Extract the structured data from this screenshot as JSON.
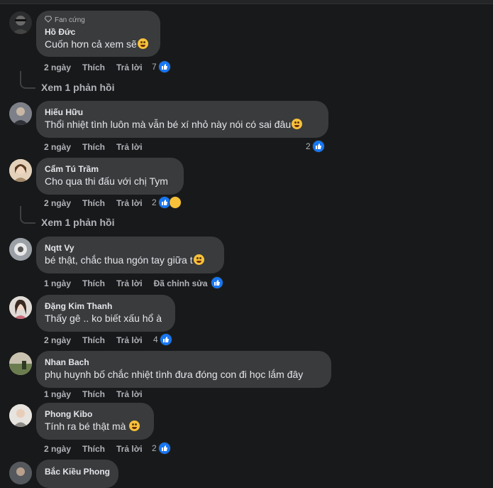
{
  "comments": [
    {
      "author": "Hồ Đức",
      "badge": "Fan cứng",
      "text": "Cuốn hơn cả xem sẽ",
      "emoji": "grin-sweat-icon",
      "time": "2 ngày",
      "like": "Thích",
      "reply": "Trả lời",
      "reactions": "7",
      "see_replies": "Xem 1 phản hồi"
    },
    {
      "author": "Hiếu Hữu",
      "text": "Thổi nhiệt tình luôn mà vẫn bé xí nhỏ này nói có sai đâu",
      "emoji": "rofl-icon",
      "time": "2 ngày",
      "like": "Thích",
      "reply": "Trả lời",
      "reactions": "2"
    },
    {
      "author": "Cẩm Tú Trầm",
      "text": "Cho qua thi đấu với chị Tym",
      "time": "2 ngày",
      "like": "Thích",
      "reply": "Trả lời",
      "reactions": "2",
      "see_replies": "Xem 1 phản hồi"
    },
    {
      "author": "Nqtt Vy",
      "text": "bé thật, chắc thua ngón tay giữa t",
      "emoji": "crying-icon",
      "time": "1 ngày",
      "like": "Thích",
      "reply": "Trả lời",
      "edited": "Đã chỉnh sửa"
    },
    {
      "author": "Đặng Kim Thanh",
      "text": "Thấy gê .. ko biết xấu hổ à",
      "time": "2 ngày",
      "like": "Thích",
      "reply": "Trả lời",
      "reactions": "4"
    },
    {
      "author": "Nhan Bach",
      "text": "phụ huynh bố chắc nhiệt tình đưa đóng con đi học lắm đây",
      "time": "1 ngày",
      "like": "Thích",
      "reply": "Trả lời"
    },
    {
      "author": "Phong Kibo",
      "text": "Tính ra bé thật mà",
      "emoji": "smirk-icon",
      "time": "2 ngày",
      "like": "Thích",
      "reply": "Trả lời",
      "reactions": "2"
    },
    {
      "author": "Bắc Kiều Phong"
    }
  ],
  "colors": {
    "background": "#18191a",
    "bubble": "#3a3b3c",
    "like_blue": "#1877f2"
  }
}
